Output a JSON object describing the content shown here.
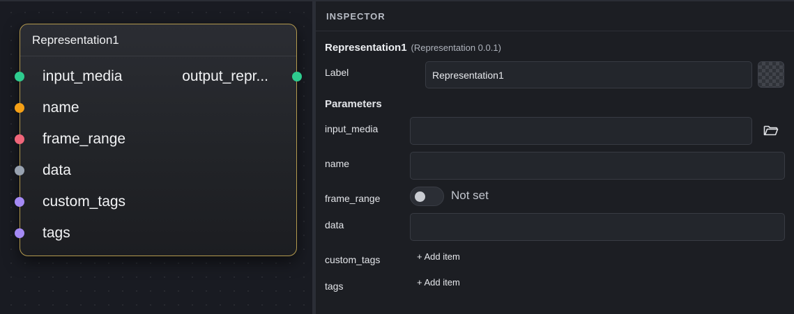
{
  "canvas": {
    "node": {
      "title": "Representation1",
      "border_color": "#b49a4e",
      "inputs": [
        {
          "label": "input_media",
          "color": "#2ecc8f"
        },
        {
          "label": "name",
          "color": "#f5a016"
        },
        {
          "label": "frame_range",
          "color": "#f0667a"
        },
        {
          "label": "data",
          "color": "#98a2b0"
        },
        {
          "label": "custom_tags",
          "color": "#a58af5"
        },
        {
          "label": "tags",
          "color": "#a58af5"
        }
      ],
      "outputs": [
        {
          "label": "output_repr...",
          "color": "#2ecc8f"
        }
      ]
    }
  },
  "inspector": {
    "header": "INSPECTOR",
    "node_name": "Representation1",
    "node_version": "(Representation 0.0.1)",
    "label_caption": "Label",
    "label_value": "Representation1",
    "parameters_heading": "Parameters",
    "params": {
      "input_media": {
        "label": "input_media",
        "value": ""
      },
      "name": {
        "label": "name",
        "value": ""
      },
      "frame_range": {
        "label": "frame_range",
        "toggle_text": "Not set"
      },
      "data": {
        "label": "data",
        "value": ""
      },
      "custom_tags": {
        "label": "custom_tags",
        "add_label": "+ Add item"
      },
      "tags": {
        "label": "tags",
        "add_label": "+ Add item"
      }
    },
    "icons": {
      "browse": "folder-icon",
      "color_swatch": "checkerboard-swatch-icon"
    }
  }
}
